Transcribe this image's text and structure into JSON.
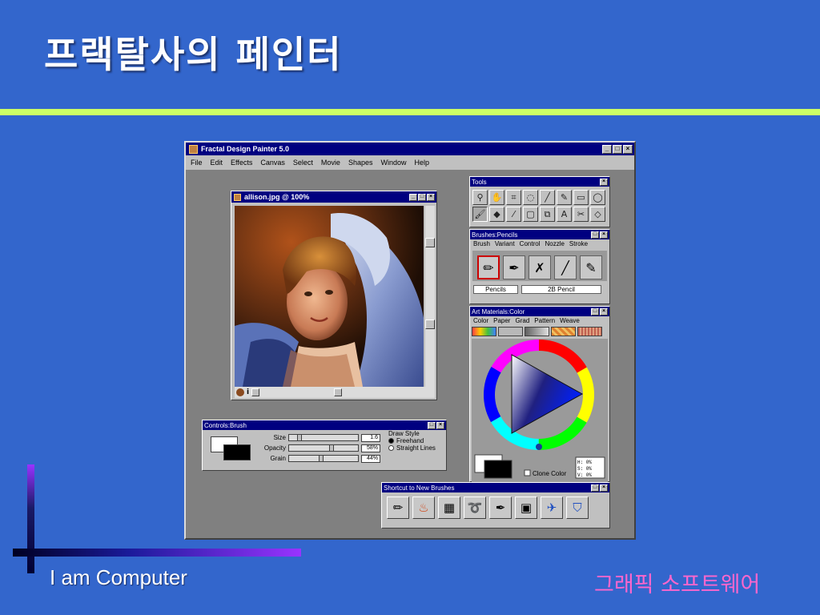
{
  "slide": {
    "title": "프랙탈사의 페인터",
    "footer_left": "I am Computer",
    "footer_right": "그래픽 소프트웨어"
  },
  "app": {
    "title": "Fractal Design Painter 5.0",
    "menu": [
      "File",
      "Edit",
      "Effects",
      "Canvas",
      "Select",
      "Movie",
      "Shapes",
      "Window",
      "Help"
    ],
    "document": {
      "title": "allison.jpg @ 100%"
    },
    "tools_panel": {
      "title": "Tools"
    },
    "brushes_panel": {
      "title": "Brushes:Pencils",
      "tabs": [
        "Brush",
        "Variant",
        "Control",
        "Nozzle",
        "Stroke"
      ],
      "category": "Pencils",
      "variant": "2B Pencil"
    },
    "art_materials": {
      "title": "Art Materials:Color",
      "tabs": [
        "Color",
        "Paper",
        "Grad",
        "Pattern",
        "Weave"
      ],
      "clone_color_label": "Clone Color",
      "hsv": {
        "h": "H:  0%",
        "s": "S:  0%",
        "v": "V:  0%"
      }
    },
    "controls_brush": {
      "title": "Controls:Brush",
      "size_label": "Size",
      "size_value": "1.6",
      "opacity_label": "Opacity",
      "opacity_value": "58%",
      "grain_label": "Grain",
      "grain_value": "44%",
      "draw_style_label": "Draw Style",
      "freehand_label": "Freehand",
      "straight_label": "Straight Lines"
    },
    "shortcut_panel": {
      "title": "Shortcut to New Brushes"
    }
  },
  "colors": {
    "background": "#3366cc",
    "rule": "#ccff66",
    "footer_right": "#ff66cc",
    "titlebar": "#000080"
  }
}
